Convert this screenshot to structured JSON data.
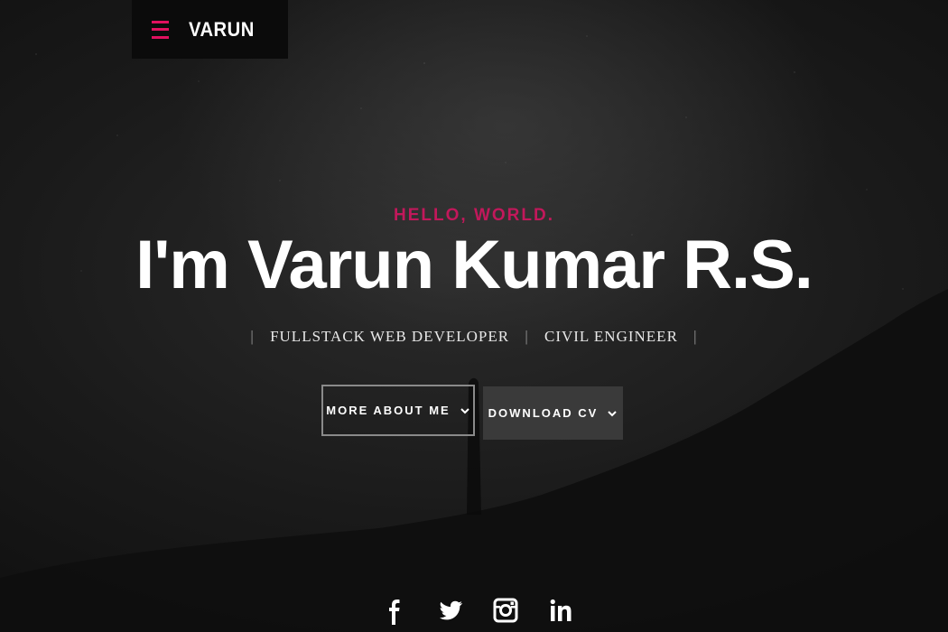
{
  "nav": {
    "brand": "VARUN",
    "menu_icon": "hamburger-menu-icon"
  },
  "hero": {
    "greeting": "HELLO, WORLD.",
    "title": "I'm Varun Kumar R.S.",
    "roles": [
      "FULLSTACK WEB DEVELOPER",
      "CIVIL ENGINEER"
    ],
    "more_button": "MORE ABOUT ME",
    "download_button": "DOWNLOAD CV"
  },
  "social": [
    "facebook-icon",
    "twitter-icon",
    "instagram-icon",
    "linkedin-icon"
  ],
  "colors": {
    "accent": "#e0115f",
    "greeting": "#c2185b",
    "background": "#121212",
    "secondary_button": "#3a3a3a"
  }
}
